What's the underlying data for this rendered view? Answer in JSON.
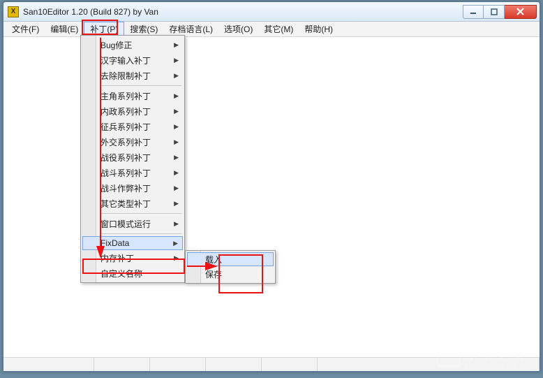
{
  "window": {
    "title": "San10Editor 1.20 (Build 827) by Van",
    "app_icon_letter": "X"
  },
  "menubar": [
    {
      "label": "文件(F)",
      "key": "file"
    },
    {
      "label": "编辑(E)",
      "key": "edit"
    },
    {
      "label": "补丁(P)",
      "key": "patch",
      "active": true
    },
    {
      "label": "搜索(S)",
      "key": "search"
    },
    {
      "label": "存档语言(L)",
      "key": "lang"
    },
    {
      "label": "选项(O)",
      "key": "options"
    },
    {
      "label": "其它(M)",
      "key": "misc"
    },
    {
      "label": "帮助(H)",
      "key": "help"
    }
  ],
  "dropdown_main": {
    "groups": [
      [
        {
          "label": "Bug修正",
          "submenu": true
        },
        {
          "label": "汉字输入补丁",
          "submenu": true
        },
        {
          "label": "去除限制补丁",
          "submenu": true
        }
      ],
      [
        {
          "label": "主角系列补丁",
          "submenu": true
        },
        {
          "label": "内政系列补丁",
          "submenu": true
        },
        {
          "label": "征兵系列补丁",
          "submenu": true
        },
        {
          "label": "外交系列补丁",
          "submenu": true
        },
        {
          "label": "战役系列补丁",
          "submenu": true
        },
        {
          "label": "战斗系列补丁",
          "submenu": true
        },
        {
          "label": "战斗作弊补丁",
          "submenu": true
        },
        {
          "label": "其它类型补丁",
          "submenu": true
        }
      ],
      [
        {
          "label": "窗口模式运行",
          "submenu": true
        }
      ],
      [
        {
          "label": "FixData",
          "submenu": true,
          "hover": true
        },
        {
          "label": "内存补丁",
          "submenu": true
        },
        {
          "label": "自定义名称",
          "submenu": false
        }
      ]
    ]
  },
  "dropdown_sub": {
    "items": [
      {
        "label": "载入",
        "hover": true
      },
      {
        "label": "保存"
      }
    ]
  },
  "watermark": {
    "text_cn": "系统之家",
    "text_en": "XITONGZHIJIA.NET"
  }
}
